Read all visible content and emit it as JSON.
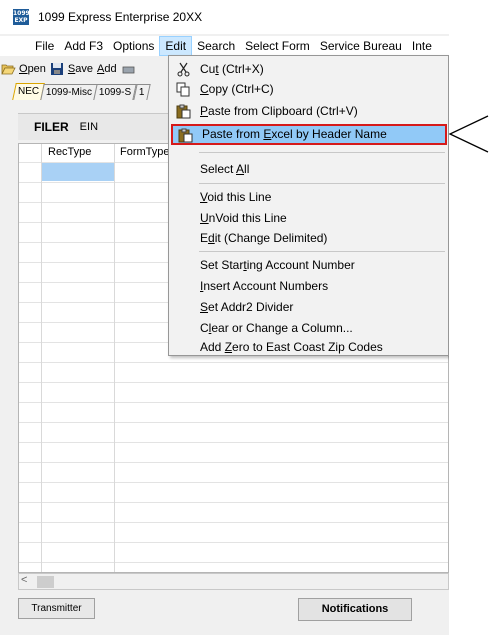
{
  "window": {
    "title": "1099 Express Enterprise 20XX",
    "app_icon_text": "1099 EXP"
  },
  "menubar": [
    "File",
    "Add F3",
    "Options",
    "Edit",
    "Search",
    "Select Form",
    "Service Bureau",
    "Inte"
  ],
  "toolbar": {
    "open": "Open",
    "open_key": "O",
    "save": "Save",
    "save_key": "S",
    "add": "Add",
    "add_key": "A"
  },
  "tabs": [
    "NEC",
    "1099-Misc",
    "1099-S",
    "1"
  ],
  "filer": {
    "label": "FILER",
    "ein": "EIN"
  },
  "grid": {
    "columns": [
      "RecType",
      "FormType"
    ]
  },
  "statusbar": {
    "transmitter": "Transmitter",
    "notifications": "Notifications"
  },
  "edit_menu": {
    "cut": {
      "pre": "Cu",
      "key": "t",
      "post": " (Ctrl+X)"
    },
    "copy": {
      "pre": "",
      "key": "C",
      "post": "opy (Ctrl+C)"
    },
    "paste_clipboard": {
      "pre": "",
      "key": "P",
      "post": "aste from Clipboard (Ctrl+V)"
    },
    "paste_excel": {
      "pre": "Paste from ",
      "key": "E",
      "post": "xcel by Header Name"
    },
    "select_all": {
      "pre": "Select ",
      "key": "A",
      "post": "ll"
    },
    "void_line": {
      "pre": "",
      "key": "V",
      "post": "oid this Line"
    },
    "unvoid_line": {
      "pre": "",
      "key": "U",
      "post": "nVoid this Line"
    },
    "edit_change": {
      "pre": "E",
      "key": "d",
      "post": "it (Change Delimited)"
    },
    "set_starting": {
      "pre": "Set Star",
      "key": "t",
      "post": "ing Account Number"
    },
    "insert_account": {
      "pre": "",
      "key": "I",
      "post": "nsert Account Numbers"
    },
    "set_addr2": {
      "pre": "",
      "key": "S",
      "post": "et Addr2 Divider"
    },
    "clear_change": {
      "pre": "C",
      "key": "l",
      "post": "ear or Change a Column..."
    },
    "add_zero": {
      "pre": "Add ",
      "key": "Z",
      "post": "ero to East Coast Zip Codes"
    }
  },
  "colors": {
    "menu_highlight": "#91c9f7",
    "callout_border": "#d61a1a",
    "selected_cell": "#a9d1f5"
  }
}
